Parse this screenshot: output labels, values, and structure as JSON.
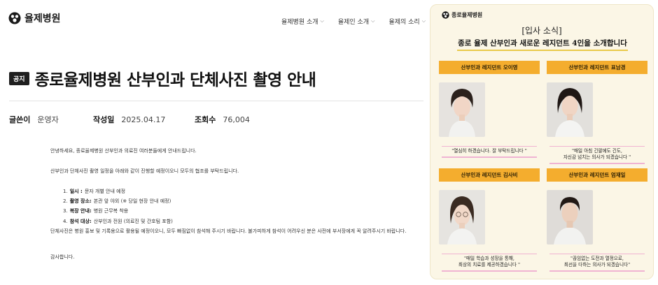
{
  "header": {
    "logo_text": "율제병원",
    "nav": [
      {
        "label": "율제병원 소개"
      },
      {
        "label": "율제인 소개"
      },
      {
        "label": "율제의 소리"
      }
    ]
  },
  "post": {
    "badge": "공지",
    "title": "종로율제병원 산부인과 단체사진 촬영 안내",
    "meta": {
      "author_label": "글쓴이",
      "author": "운영자",
      "date_label": "작성일",
      "date": "2025.04.17",
      "views_label": "조회수",
      "views": "76,004"
    },
    "greeting": "안녕하세요, 종로율제병원 산부인과 의료진 여러분들에게 안내드립니다.",
    "intro": "산부인과 단체사진 촬영 일정을 아래와 같이 진행할 예정이오니 모두의 협조를 부탁드립니다.",
    "items": [
      {
        "num": "1.",
        "label": "일시 :",
        "text": "문자 개별 안내 예정"
      },
      {
        "num": "2.",
        "label": "촬영 장소:",
        "text": "본관 앞 야외 (※ 당일 현장 안내 예정)"
      },
      {
        "num": "3.",
        "label": "복장 안내:",
        "text": "병원 근무복 착용"
      },
      {
        "num": "4.",
        "label": "참석 대상:",
        "text": "산부인과 전원 (의료진 및 간호팀 포함)"
      }
    ],
    "note": "단체사진은 병원 홍보 및 기록용으로 활용될 예정이오니, 모두 빠짐없이 참석해 주시기 바랍니다. 불가피하게 참석이 어려우신 분은 사전에 부서장에게 꼭 알려주시기 바랍니다.",
    "closing": "감사합니다."
  },
  "poster": {
    "logo_text": "종로율제병원",
    "heading": "[입사 소식]",
    "subheading": "종로 율제 산부인과 새로운 레지던트 4인을 소개합니다",
    "cards": [
      {
        "label": "산부인과 레지던트 오이영",
        "quote1": "\"열심히 하겠습니다. 잘 부탁드립니다 \"",
        "quote2": ""
      },
      {
        "label": "산부인과 레지던트 표남경",
        "quote1": "\"매일 아침 긴팔에도 긴도,",
        "quote2": "자신감 넘치는 의사가 되겠습니다 \""
      },
      {
        "label": "산부인과 레지던트 김사비",
        "quote1": "\"매일 학습과 성장을 통해,",
        "quote2": "최상의 치료를 제공하겠습니다 \""
      },
      {
        "label": "산부인과 레지던트 엄재일",
        "quote1": "\"끊임없는 도전과 열정으로,",
        "quote2": "최선을 다하는 의사가 되겠습니다\""
      }
    ]
  }
}
